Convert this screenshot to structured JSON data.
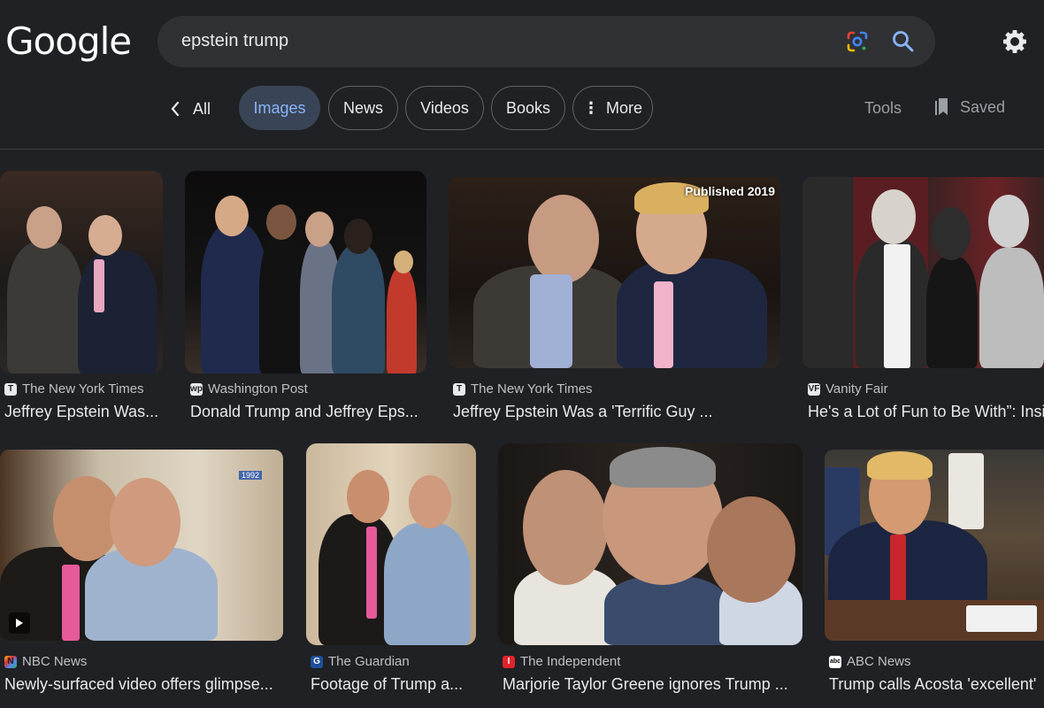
{
  "header": {
    "logo": "Google",
    "query": "epstein trump"
  },
  "filters": {
    "back_label": "All",
    "chips": [
      "Images",
      "News",
      "Videos",
      "Books",
      "More"
    ],
    "tools_label": "Tools",
    "saved_label": "Saved"
  },
  "results": [
    {
      "source": "The New York Times",
      "title": "Jeffrey Epstein Was...",
      "favicon": "T"
    },
    {
      "source": "Washington Post",
      "title": "Donald Trump and Jeffrey Eps...",
      "favicon": "wp"
    },
    {
      "source": "The New York Times",
      "title": "Jeffrey Epstein Was a 'Terrific Guy ...",
      "favicon": "T",
      "badge": "Published 2019"
    },
    {
      "source": "Vanity Fair",
      "title": "He's a Lot of Fun to Be With”: Insi",
      "favicon": "VF"
    },
    {
      "source": "NBC News",
      "title": "Newly-surfaced video offers glimpse...",
      "favicon": "N"
    },
    {
      "source": "The Guardian",
      "title": "Footage of Trump a...",
      "favicon": "G"
    },
    {
      "source": "The Independent",
      "title": "Marjorie Taylor Greene ignores Trump ...",
      "favicon": "I"
    },
    {
      "source": "ABC News",
      "title": "Trump calls Acosta 'excellent'",
      "favicon": "abc"
    }
  ],
  "thumb_badges": {
    "year_1992": "1992"
  },
  "colors": {
    "background": "#202124",
    "accent_chip": "#394457",
    "accent_text": "#8ab4f8"
  }
}
